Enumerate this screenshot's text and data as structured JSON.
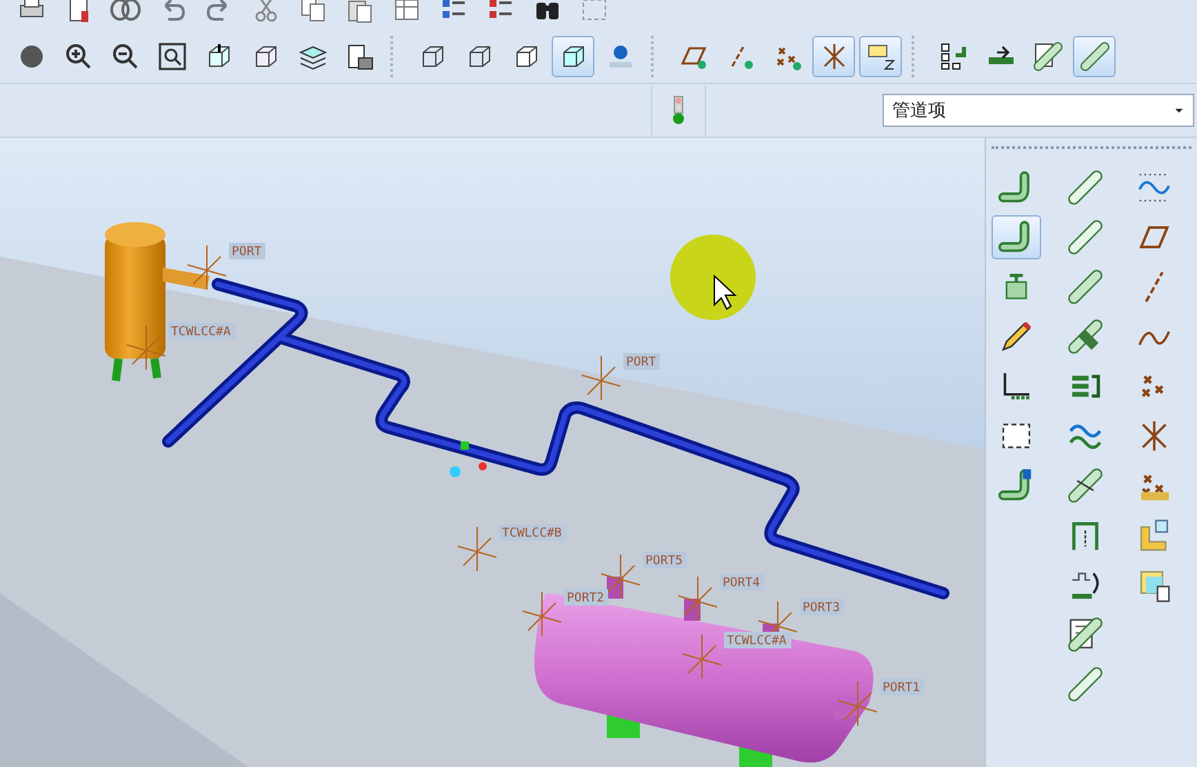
{
  "toolbar_top": [
    {
      "pressed": false
    },
    {
      "pressed": false
    },
    {
      "pressed": false
    },
    {
      "pressed": false
    },
    {
      "pressed": false
    },
    {
      "pressed": false
    },
    {
      "pressed": false
    },
    {
      "pressed": false
    },
    {
      "pressed": false
    },
    {
      "pressed": false
    },
    {
      "pressed": false
    },
    {
      "pressed": false
    },
    {
      "pressed": false
    }
  ],
  "toolbar_view": [
    [
      {
        "pressed": false
      },
      {
        "pressed": false
      },
      {
        "pressed": false
      },
      {
        "pressed": false
      },
      {
        "pressed": false
      },
      {
        "pressed": false
      },
      {
        "pressed": false
      },
      {
        "pressed": false
      }
    ],
    [
      {
        "pressed": false
      },
      {
        "pressed": false
      },
      {
        "pressed": false
      },
      {
        "pressed": true
      },
      {
        "pressed": false
      }
    ],
    [
      {
        "pressed": false
      },
      {
        "pressed": false
      },
      {
        "pressed": false
      },
      {
        "pressed": true
      },
      {
        "pressed": true
      }
    ],
    [
      {
        "pressed": false
      },
      {
        "pressed": false
      },
      {
        "pressed": false
      },
      {
        "pressed": true
      }
    ]
  ],
  "filter": {
    "value": "管道项"
  },
  "viewport": {
    "labels": [
      {
        "text": "PORT"
      },
      {
        "text": "TCWLCC#A"
      },
      {
        "text": "PORT"
      },
      {
        "text": "TCWLCC#B"
      },
      {
        "text": "PORT5"
      },
      {
        "text": "PORT4"
      },
      {
        "text": "PORT2"
      },
      {
        "text": "PORT3"
      },
      {
        "text": "TCWLCC#A"
      },
      {
        "text": "PORT1"
      }
    ]
  },
  "palette": [
    [
      {
        "pressed": false
      },
      {
        "pressed": true
      },
      {
        "pressed": false
      },
      {
        "pressed": false
      },
      {
        "pressed": false
      },
      {
        "pressed": false
      },
      {
        "pressed": false
      }
    ],
    [
      {
        "pressed": false
      },
      {
        "pressed": false
      },
      {
        "pressed": false
      },
      {
        "pressed": false
      },
      {
        "pressed": false
      },
      {
        "pressed": false
      },
      {
        "pressed": false
      },
      {
        "pressed": false
      },
      {
        "pressed": false
      },
      {
        "pressed": false
      },
      {
        "pressed": false
      }
    ],
    [
      {
        "pressed": false
      },
      {
        "pressed": false
      },
      {
        "pressed": false
      },
      {
        "pressed": false
      },
      {
        "pressed": false
      },
      {
        "pressed": false
      },
      {
        "pressed": false
      },
      {
        "pressed": false
      },
      {
        "pressed": false
      }
    ]
  ]
}
